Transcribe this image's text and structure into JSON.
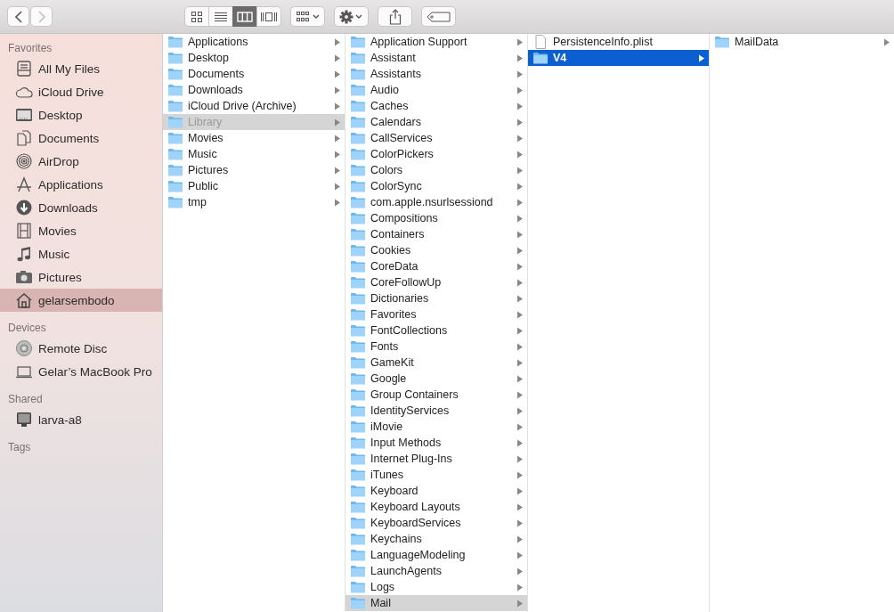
{
  "toolbar": {
    "back": {
      "disabled": false
    },
    "forward": {
      "disabled": true
    },
    "views": [
      {
        "kind": "icons",
        "selected": false
      },
      {
        "kind": "list",
        "selected": false
      },
      {
        "kind": "columns",
        "selected": true
      },
      {
        "kind": "coverflow",
        "selected": false
      }
    ]
  },
  "sidebar": [
    {
      "title": "Favorites",
      "items": [
        {
          "label": "All My Files",
          "kind": "files",
          "selected": false
        },
        {
          "label": "iCloud Drive",
          "kind": "cloud",
          "selected": false
        },
        {
          "label": "Desktop",
          "kind": "desktop",
          "selected": false
        },
        {
          "label": "Documents",
          "kind": "documents",
          "selected": false
        },
        {
          "label": "AirDrop",
          "kind": "airdrop",
          "selected": false
        },
        {
          "label": "Applications",
          "kind": "applications",
          "selected": false
        },
        {
          "label": "Downloads",
          "kind": "downloads",
          "selected": false
        },
        {
          "label": "Movies",
          "kind": "movies",
          "selected": false
        },
        {
          "label": "Music",
          "kind": "music",
          "selected": false
        },
        {
          "label": "Pictures",
          "kind": "pictures",
          "selected": false
        },
        {
          "label": "gelarsembodo",
          "kind": "home",
          "selected": true
        }
      ]
    },
    {
      "title": "Devices",
      "items": [
        {
          "label": "Remote Disc",
          "kind": "disc",
          "selected": false
        },
        {
          "label": "Gelar’s MacBook Pro",
          "kind": "laptop",
          "selected": false
        }
      ]
    },
    {
      "title": "Shared",
      "items": [
        {
          "label": "larva-a8",
          "kind": "monitor",
          "selected": false
        }
      ]
    },
    {
      "title": "Tags"
    }
  ],
  "columns": [
    {
      "focused": false,
      "items": [
        {
          "name": "Applications",
          "kind": "folder",
          "selected": false,
          "dimmed": false
        },
        {
          "name": "Desktop",
          "kind": "folder",
          "selected": false,
          "dimmed": false
        },
        {
          "name": "Documents",
          "kind": "folder",
          "selected": false,
          "dimmed": false
        },
        {
          "name": "Downloads",
          "kind": "folder",
          "selected": false,
          "dimmed": false
        },
        {
          "name": "iCloud Drive (Archive)",
          "kind": "folder",
          "selected": false,
          "dimmed": false
        },
        {
          "name": "Library",
          "kind": "folder",
          "selected": true,
          "dimmed": true
        },
        {
          "name": "Movies",
          "kind": "folder",
          "selected": false,
          "dimmed": false
        },
        {
          "name": "Music",
          "kind": "folder",
          "selected": false,
          "dimmed": false
        },
        {
          "name": "Pictures",
          "kind": "folder",
          "selected": false,
          "dimmed": false
        },
        {
          "name": "Public",
          "kind": "folder",
          "selected": false,
          "dimmed": false
        },
        {
          "name": "tmp",
          "kind": "folder",
          "selected": false,
          "dimmed": false
        }
      ]
    },
    {
      "focused": false,
      "items": [
        {
          "name": "Application Support",
          "kind": "folder",
          "selected": false,
          "dimmed": false
        },
        {
          "name": "Assistant",
          "kind": "folder",
          "selected": false,
          "dimmed": false
        },
        {
          "name": "Assistants",
          "kind": "folder",
          "selected": false,
          "dimmed": false
        },
        {
          "name": "Audio",
          "kind": "folder",
          "selected": false,
          "dimmed": false
        },
        {
          "name": "Caches",
          "kind": "folder",
          "selected": false,
          "dimmed": false
        },
        {
          "name": "Calendars",
          "kind": "folder",
          "selected": false,
          "dimmed": false
        },
        {
          "name": "CallServices",
          "kind": "folder",
          "selected": false,
          "dimmed": false
        },
        {
          "name": "ColorPickers",
          "kind": "folder",
          "selected": false,
          "dimmed": false
        },
        {
          "name": "Colors",
          "kind": "folder",
          "selected": false,
          "dimmed": false
        },
        {
          "name": "ColorSync",
          "kind": "folder",
          "selected": false,
          "dimmed": false
        },
        {
          "name": "com.apple.nsurlsessiond",
          "kind": "folder",
          "selected": false,
          "dimmed": false
        },
        {
          "name": "Compositions",
          "kind": "folder",
          "selected": false,
          "dimmed": false
        },
        {
          "name": "Containers",
          "kind": "folder",
          "selected": false,
          "dimmed": false
        },
        {
          "name": "Cookies",
          "kind": "folder",
          "selected": false,
          "dimmed": false
        },
        {
          "name": "CoreData",
          "kind": "folder",
          "selected": false,
          "dimmed": false
        },
        {
          "name": "CoreFollowUp",
          "kind": "folder",
          "selected": false,
          "dimmed": false
        },
        {
          "name": "Dictionaries",
          "kind": "folder",
          "selected": false,
          "dimmed": false
        },
        {
          "name": "Favorites",
          "kind": "folder",
          "selected": false,
          "dimmed": false
        },
        {
          "name": "FontCollections",
          "kind": "folder",
          "selected": false,
          "dimmed": false
        },
        {
          "name": "Fonts",
          "kind": "folder",
          "selected": false,
          "dimmed": false
        },
        {
          "name": "GameKit",
          "kind": "folder",
          "selected": false,
          "dimmed": false
        },
        {
          "name": "Google",
          "kind": "folder",
          "selected": false,
          "dimmed": false
        },
        {
          "name": "Group Containers",
          "kind": "folder",
          "selected": false,
          "dimmed": false
        },
        {
          "name": "IdentityServices",
          "kind": "folder",
          "selected": false,
          "dimmed": false
        },
        {
          "name": "iMovie",
          "kind": "folder",
          "selected": false,
          "dimmed": false
        },
        {
          "name": "Input Methods",
          "kind": "folder",
          "selected": false,
          "dimmed": false
        },
        {
          "name": "Internet Plug-Ins",
          "kind": "folder",
          "selected": false,
          "dimmed": false
        },
        {
          "name": "iTunes",
          "kind": "folder",
          "selected": false,
          "dimmed": false
        },
        {
          "name": "Keyboard",
          "kind": "folder",
          "selected": false,
          "dimmed": false
        },
        {
          "name": "Keyboard Layouts",
          "kind": "folder",
          "selected": false,
          "dimmed": false
        },
        {
          "name": "KeyboardServices",
          "kind": "folder",
          "selected": false,
          "dimmed": false
        },
        {
          "name": "Keychains",
          "kind": "folder",
          "selected": false,
          "dimmed": false
        },
        {
          "name": "LanguageModeling",
          "kind": "folder",
          "selected": false,
          "dimmed": false
        },
        {
          "name": "LaunchAgents",
          "kind": "folder",
          "selected": false,
          "dimmed": false
        },
        {
          "name": "Logs",
          "kind": "folder",
          "selected": false,
          "dimmed": false
        },
        {
          "name": "Mail",
          "kind": "folder",
          "selected": true,
          "dimmed": false
        }
      ]
    },
    {
      "focused": true,
      "items": [
        {
          "name": "PersistenceInfo.plist",
          "kind": "file",
          "selected": false,
          "dimmed": false
        },
        {
          "name": "V4",
          "kind": "folder",
          "selected": true,
          "dimmed": false
        }
      ]
    },
    {
      "items": [
        {
          "name": "MailData",
          "kind": "folder",
          "selected": false,
          "dimmed": false
        }
      ]
    }
  ]
}
